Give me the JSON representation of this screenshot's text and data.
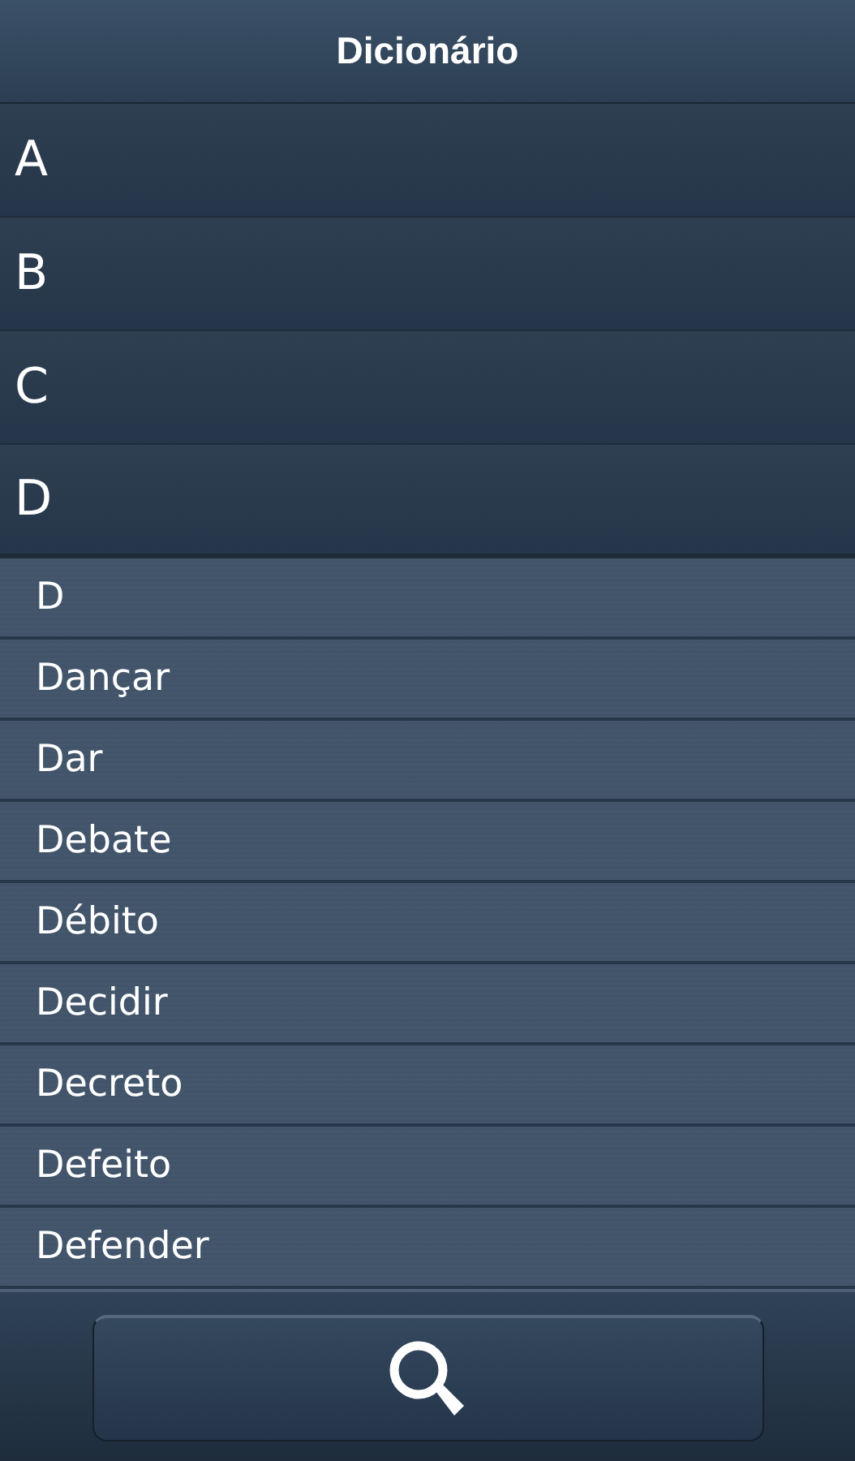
{
  "header": {
    "title": "Dicionário"
  },
  "sections": [
    {
      "letter": "A",
      "expanded": false
    },
    {
      "letter": "B",
      "expanded": false
    },
    {
      "letter": "C",
      "expanded": false
    },
    {
      "letter": "D",
      "expanded": true,
      "children": [
        "D",
        "Dançar",
        "Dar",
        "Debate",
        "Débito",
        "Decidir",
        "Decreto",
        "Defeito",
        "Defender"
      ]
    }
  ]
}
